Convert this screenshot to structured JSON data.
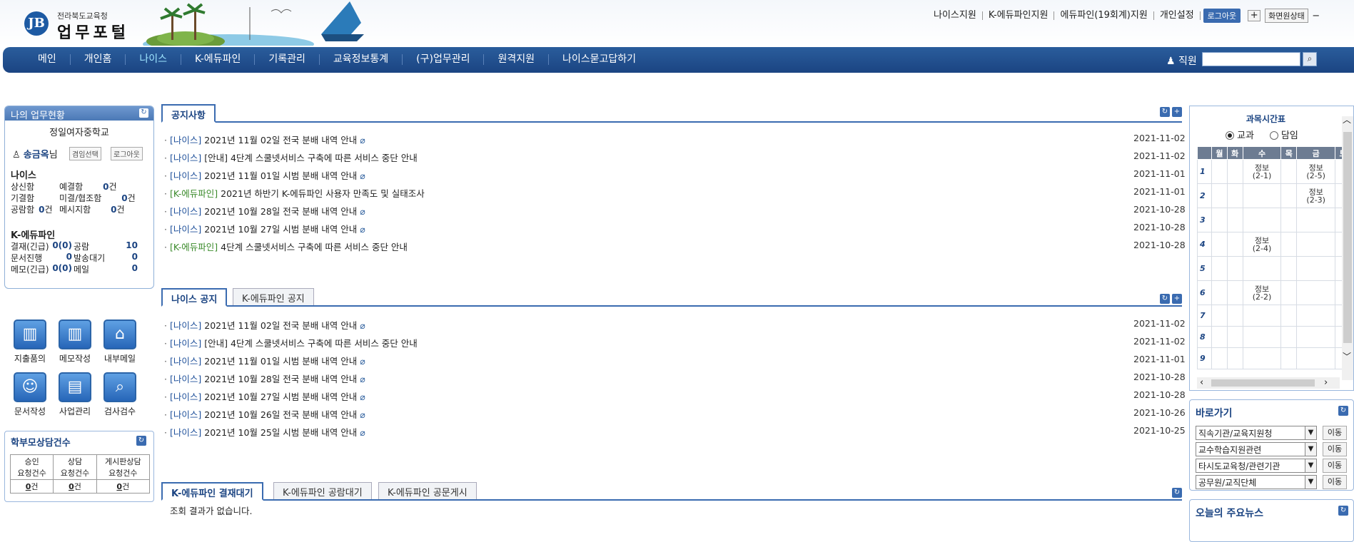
{
  "header": {
    "logo_sub": "전라북도교육청",
    "logo_title": "업무포털",
    "logo_mark": "JB",
    "top_links": [
      "나이스지원",
      "K-에듀파인지원",
      "에듀파인(19회계)지원",
      "개인설정"
    ],
    "logout": "로그아웃",
    "plus": "+",
    "screen_state": "화면원상태",
    "minus": "−"
  },
  "nav": {
    "items": [
      "메인",
      "개인홈",
      "나이스",
      "K-에듀파인",
      "기록관리",
      "교육정보통계",
      "(구)업무관리",
      "원격지원",
      "나이스묻고답하기"
    ],
    "active_index": 2,
    "staff_label": "직원"
  },
  "mywork": {
    "title": "나의 업무현황",
    "school": "정일여자중학교",
    "user": "송금옥",
    "user_suffix": "님",
    "choose_btn": "겸임선택",
    "logout_btn": "로그아웃",
    "neis_title": "나이스",
    "neis": [
      {
        "k": "상신함",
        "v": ""
      },
      {
        "k": "예결함",
        "v": "0",
        "u": "건"
      },
      {
        "k": "기결함",
        "v": ""
      },
      {
        "k": "미결/협조함",
        "v": "0",
        "u": "건"
      },
      {
        "k": "공람함",
        "v": "0",
        "u": "건"
      },
      {
        "k": "메시지함",
        "v": "0",
        "u": "건"
      }
    ],
    "edufine_title": "K-에듀파인",
    "edufine": [
      {
        "k": "결재(긴급)",
        "v": "0(0)"
      },
      {
        "k": "공람",
        "v": "10"
      },
      {
        "k": "문서진행",
        "v": "0"
      },
      {
        "k": "발송대기",
        "v": "0"
      },
      {
        "k": "메모(긴급)",
        "v": "0(0)"
      },
      {
        "k": "메일",
        "v": "0"
      }
    ]
  },
  "quick_icons": [
    {
      "label": "지출품의",
      "icon": "chart-icon"
    },
    {
      "label": "메모작성",
      "icon": "chart-icon"
    },
    {
      "label": "내부메일",
      "icon": "home-icon"
    },
    {
      "label": "문서작성",
      "icon": "person-icon"
    },
    {
      "label": "사업관리",
      "icon": "document-icon"
    },
    {
      "label": "검사검수",
      "icon": "magnifier-icon"
    }
  ],
  "counsel": {
    "title": "학부모상담건수",
    "headers": [
      "승인\n요청건수",
      "상담\n요청건수",
      "게시판상담\n요청건수"
    ],
    "h": [
      [
        "승인",
        "요청건수"
      ],
      [
        "상담",
        "요청건수"
      ],
      [
        "게시판상담",
        "요청건수"
      ]
    ],
    "values": [
      "0",
      "0",
      "0"
    ],
    "unit": "건"
  },
  "notice": {
    "tab": "공지사항",
    "rows": [
      {
        "cat": "[나이스]",
        "text": "2021년 11월 02일 전국 분배 내역 안내",
        "clip": true,
        "date": "2021-11-02"
      },
      {
        "cat": "[나이스]",
        "text": "[안내] 4단계 스쿨넷서비스 구축에 따른 서비스 중단 안내",
        "clip": false,
        "date": "2021-11-02"
      },
      {
        "cat": "[나이스]",
        "text": "2021년 11월 01일 시범 분배 내역 안내",
        "clip": true,
        "date": "2021-11-01"
      },
      {
        "cat": "[K-에듀파인]",
        "text": "2021년 하반기 K-에듀파인 사용자 만족도 및 실태조사",
        "clip": false,
        "date": "2021-11-01",
        "green": true
      },
      {
        "cat": "[나이스]",
        "text": "2021년 10월 28일 전국 분배 내역 안내",
        "clip": true,
        "date": "2021-10-28"
      },
      {
        "cat": "[나이스]",
        "text": "2021년 10월 27일 시범 분배 내역 안내",
        "clip": true,
        "date": "2021-10-28"
      },
      {
        "cat": "[K-에듀파인]",
        "text": "4단계 스쿨넷서비스 구축에 따른 서비스 중단 안내",
        "clip": false,
        "date": "2021-10-28",
        "green": true
      }
    ]
  },
  "neis_notice": {
    "tabs": [
      "나이스 공지",
      "K-에듀파인 공지"
    ],
    "rows": [
      {
        "cat": "[나이스]",
        "text": "2021년 11월 02일 전국 분배 내역 안내",
        "clip": true,
        "date": "2021-11-02"
      },
      {
        "cat": "[나이스]",
        "text": "[안내] 4단계 스쿨넷서비스 구축에 따른 서비스 중단 안내",
        "clip": false,
        "date": "2021-11-02"
      },
      {
        "cat": "[나이스]",
        "text": "2021년 11월 01일 시범 분배 내역 안내",
        "clip": true,
        "date": "2021-11-01"
      },
      {
        "cat": "[나이스]",
        "text": "2021년 10월 28일 전국 분배 내역 안내",
        "clip": true,
        "date": "2021-10-28"
      },
      {
        "cat": "[나이스]",
        "text": "2021년 10월 27일 시범 분배 내역 안내",
        "clip": true,
        "date": "2021-10-28"
      },
      {
        "cat": "[나이스]",
        "text": "2021년 10월 26일 전국 분배 내역 안내",
        "clip": true,
        "date": "2021-10-26"
      },
      {
        "cat": "[나이스]",
        "text": "2021년 10월 25일 시범 분배 내역 안내",
        "clip": true,
        "date": "2021-10-25"
      }
    ]
  },
  "edufine": {
    "tabs": [
      "K-에듀파인 결재대기",
      "K-에듀파인 공람대기",
      "K-에듀파인 공문게시"
    ],
    "empty": "조회 결과가 없습니다."
  },
  "timetable": {
    "title": "과목시간표",
    "radio": [
      "교과",
      "담임"
    ],
    "days": [
      "월",
      "화",
      "수",
      "목",
      "금",
      "토"
    ],
    "periods": [
      "1",
      "2",
      "3",
      "4",
      "5",
      "6",
      "7",
      "8",
      "9"
    ],
    "cells": [
      [
        "",
        "",
        "정보\n(2-1)",
        "",
        "정보\n(2-5)",
        ""
      ],
      [
        "",
        "",
        "",
        "",
        "정보\n(2-3)",
        ""
      ],
      [
        "",
        "",
        "",
        "",
        "",
        ""
      ],
      [
        "",
        "",
        "정보\n(2-4)",
        "",
        "",
        ""
      ],
      [
        "",
        "",
        "",
        "",
        "",
        ""
      ],
      [
        "",
        "",
        "정보\n(2-2)",
        "",
        "",
        ""
      ],
      [
        "",
        "",
        "",
        "",
        "",
        ""
      ],
      [
        "",
        "",
        "",
        "",
        "",
        ""
      ],
      [
        "",
        "",
        "",
        "",
        "",
        ""
      ]
    ]
  },
  "shortcut": {
    "title": "바로가기",
    "selects": [
      "직속기관/교육지원청",
      "교수학습지원관련",
      "타시도교육청/관련기관",
      "공무원/교직단체"
    ],
    "go": "이동"
  },
  "news": {
    "title": "오늘의 주요뉴스"
  },
  "colors": {
    "nav": "#1b4482",
    "accent": "#3a6bb0",
    "green_cat": "#3a8a2a",
    "active_nav": "#9fe6ff"
  }
}
